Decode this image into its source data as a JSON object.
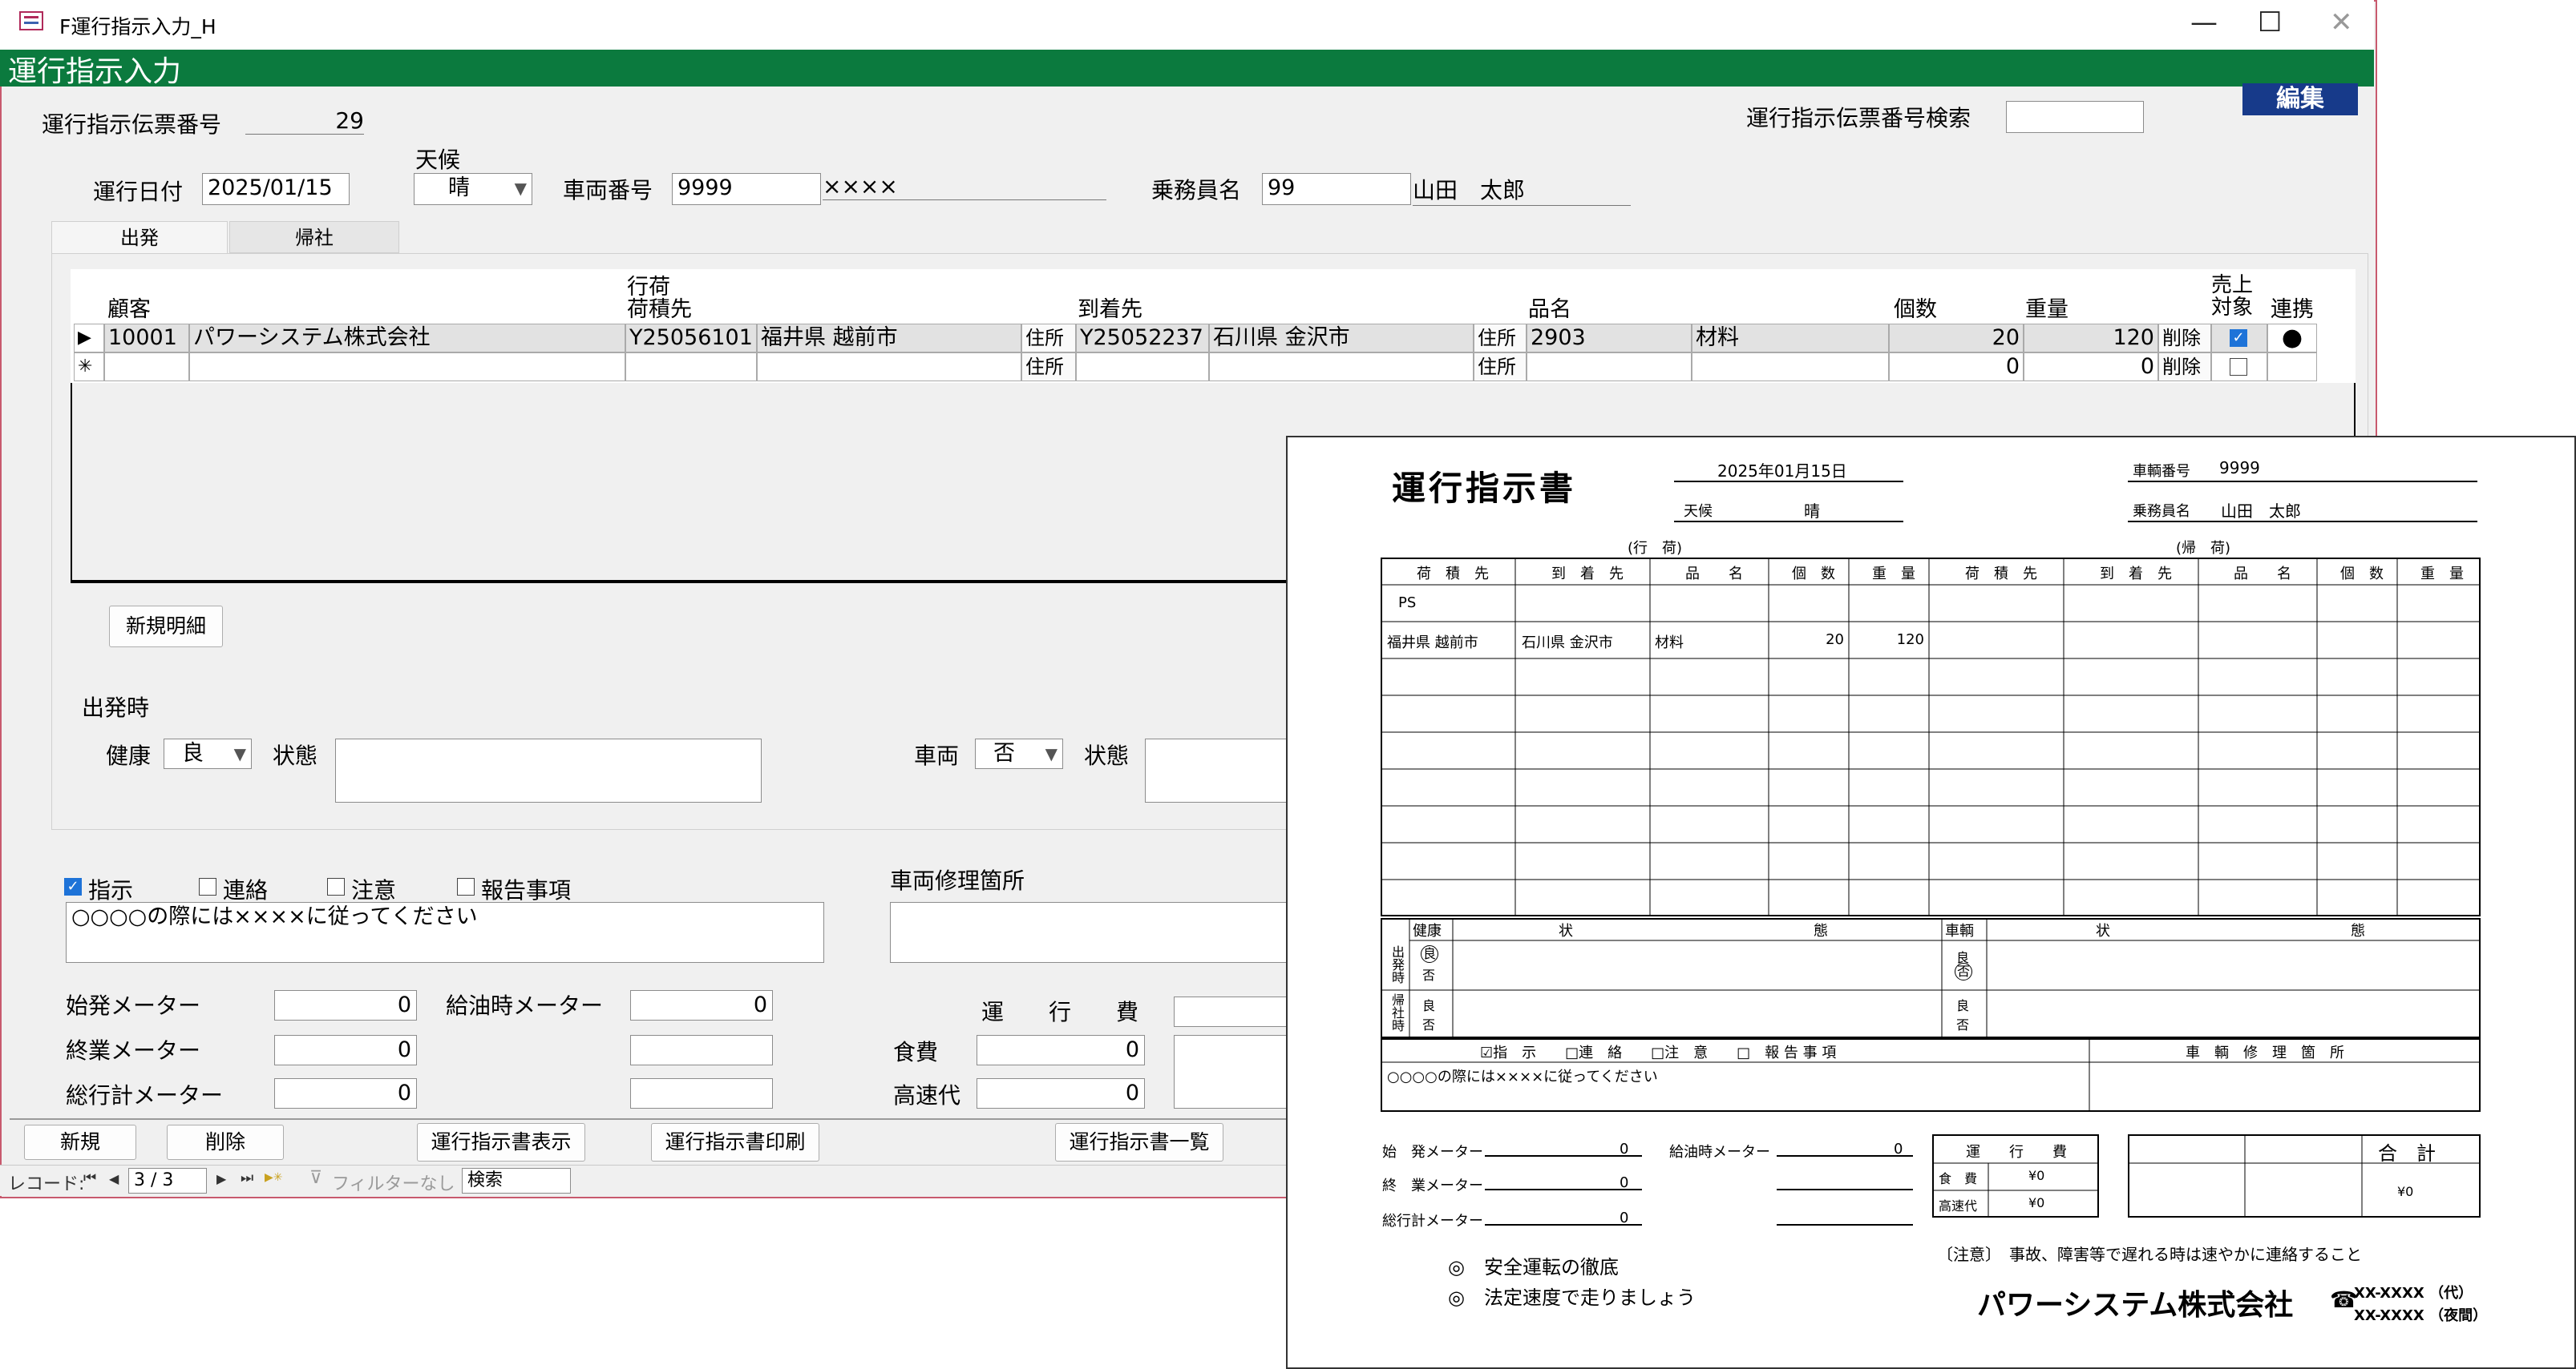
{
  "window": {
    "title": "F運行指示入力_H",
    "icon": "form-icon",
    "controls": {
      "minimize": "—",
      "maximize": "☐",
      "close": "✕"
    }
  },
  "header": {
    "title": "運行指示入力",
    "edit_button": "編集"
  },
  "form": {
    "slip_no_label": "運行指示伝票番号",
    "slip_no_value": "29",
    "search_label": "運行指示伝票番号検索",
    "search_value": "",
    "date_label": "運行日付",
    "date_value": "2025/01/15",
    "weather_label": "天候",
    "weather_value": "晴",
    "vehicle_label": "車両番号",
    "vehicle_no": "9999",
    "vehicle_name": "××××",
    "crew_label": "乗務員名",
    "crew_no": "99",
    "crew_name": "山田　太郎"
  },
  "tabs": [
    {
      "label": "出発"
    },
    {
      "label": "帰社"
    }
  ],
  "grid": {
    "headers": {
      "customer": "顧客",
      "outbound": "行荷",
      "loading": "荷積先",
      "arrival": "到着先",
      "product": "品名",
      "qty": "個数",
      "weight": "重量",
      "sales": "売上\n対象",
      "sales_line1": "売上",
      "sales_line2": "対象",
      "link": "連携"
    },
    "rows": [
      {
        "selector": "▶",
        "cust_code": "10001",
        "cust_name": "パワーシステム株式会社",
        "load_code": "Y25056101",
        "load_place": "福井県 越前市",
        "addr1": "住所",
        "arr_code": "Y25052237",
        "arr_place": "石川県 金沢市",
        "addr2": "住所",
        "prod_code": "2903",
        "prod_name": "材料",
        "qty": "20",
        "weight": "120",
        "delete": "削除",
        "sales": true,
        "link": "●"
      },
      {
        "selector": "✳",
        "cust_code": "",
        "cust_name": "",
        "load_code": "",
        "load_place": "",
        "addr1": "住所",
        "arr_code": "",
        "arr_place": "",
        "addr2": "住所",
        "prod_code": "",
        "prod_name": "",
        "qty": "0",
        "weight": "0",
        "delete": "削除",
        "sales": false,
        "link": ""
      }
    ],
    "new_detail_button": "新規明細"
  },
  "departure": {
    "section_label": "出発時",
    "health_label": "健康",
    "health_value": "良",
    "status_label": "状態",
    "vehicle_label": "車両",
    "vehicle_value": "否",
    "vehicle_status_label": "状態"
  },
  "instructions": {
    "checks": [
      {
        "label": "指示",
        "checked": true
      },
      {
        "label": "連絡",
        "checked": false
      },
      {
        "label": "注意",
        "checked": false
      },
      {
        "label": "報告事項",
        "checked": false
      }
    ],
    "text": "○○○○の際には××××に従ってください",
    "repair_label": "車両修理箇所"
  },
  "meters": {
    "start_label": "始発メーター",
    "start_value": "0",
    "end_label": "終業メーター",
    "end_value": "0",
    "total_label": "総行計メーター",
    "total_value": "0",
    "fuel_label": "給油時メーター",
    "fuel_value": "0",
    "cost_label": "運　　行　　費",
    "food_label": "食費",
    "food_value": "0",
    "highway_label": "高速代",
    "highway_value": "0"
  },
  "footer_buttons": {
    "new": "新規",
    "delete": "削除",
    "show": "運行指示書表示",
    "print": "運行指示書印刷",
    "list": "運行指示書一覧"
  },
  "nav": {
    "record_label": "レコード:",
    "first": "⏮",
    "prev": "◀",
    "position": "3 / 3",
    "next": "▶",
    "last": "⏭",
    "new": "▶✳",
    "filter": "フィルターなし",
    "search": "検索"
  },
  "report": {
    "title": "運行指示書",
    "date": "2025年01月15日",
    "weather_label": "天候",
    "weather": "晴",
    "vehicle_label": "車輌番号",
    "vehicle": "9999",
    "crew_label": "乗務員名",
    "crew": "山田　太郎",
    "outbound_label": "(行　荷)",
    "return_label": "(帰　荷)",
    "cols": [
      "荷　積　先",
      "到　着　先",
      "品　　名",
      "個　数",
      "重　量",
      "荷　積　先",
      "到　着　先",
      "品　　名",
      "個　数",
      "重　量"
    ],
    "row0": "PS",
    "row1": {
      "load": "福井県 越前市",
      "arrive": "石川県 金沢市",
      "product": "材料",
      "qty": "20",
      "weight": "120"
    },
    "status_health": "健康",
    "status_state": "状",
    "status_state2": "態",
    "status_vehicle": "車輌",
    "depart_label": "出発時",
    "return_time_label": "帰社時",
    "good": "良",
    "bad": "否",
    "checks": "☑指　示　　□連　絡　　□注　意　　□　報 告 事 項",
    "repair_label": "車　輌　修　理　箇　所",
    "instruction_text": "○○○○の際には××××に従ってください",
    "meter_start": "始　発メーター",
    "meter_end": "終　業メーター",
    "meter_total": "総行計メーター",
    "meter_fuel": "給油時メーター",
    "meter_zero": "0",
    "cost_title": "運　　行　　費",
    "cost_food": "食　費",
    "cost_highway": "高速代",
    "cost_value": "¥0",
    "total_title": "合　計",
    "total_value": "¥0",
    "safety1": "◎　安全運転の徹底",
    "safety2": "◎　法定速度で走りましょう",
    "notice": "〔注意〕　事故、障害等で遅れる時は速やかに連絡すること",
    "company": "パワーシステム株式会社",
    "phone_icon": "☎",
    "phone1": "XX-XXXX （代）",
    "phone2": "XX-XXXX （夜間）"
  }
}
